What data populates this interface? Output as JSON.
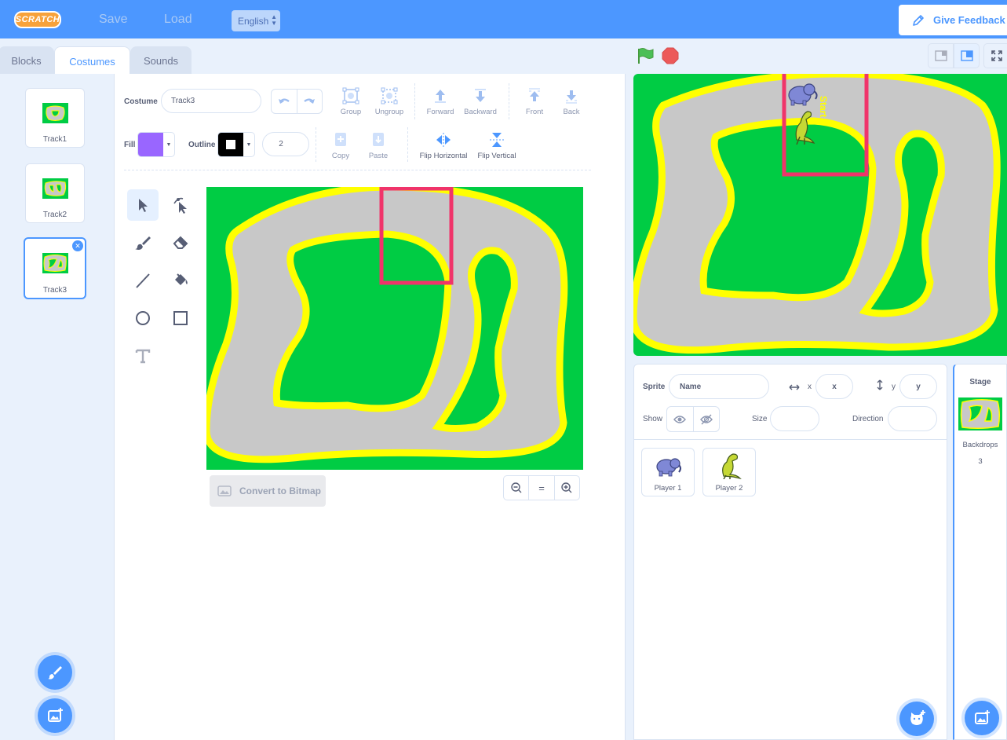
{
  "menubar": {
    "logo_text": "SCRATCH",
    "save_label": "Save",
    "load_label": "Load",
    "language": "English",
    "feedback_label": "Give Feedback"
  },
  "tabs": [
    {
      "label": "Blocks",
      "active": false
    },
    {
      "label": "Costumes",
      "active": true
    },
    {
      "label": "Sounds",
      "active": false
    }
  ],
  "costumes": [
    {
      "label": "Track1",
      "selected": false
    },
    {
      "label": "Track2",
      "selected": false
    },
    {
      "label": "Track3",
      "selected": true
    }
  ],
  "paint_editor": {
    "costume_label": "Costume",
    "costume_name": "Track3",
    "group_label": "Group",
    "ungroup_label": "Ungroup",
    "forward_label": "Forward",
    "backward_label": "Backward",
    "front_label": "Front",
    "back_label": "Back",
    "fill_label": "Fill",
    "fill_color": "#9966ff",
    "outline_label": "Outline",
    "outline_color": "#000000",
    "outline_width": "2",
    "copy_label": "Copy",
    "paste_label": "Paste",
    "flip_h_label": "Flip Horizontal",
    "flip_v_label": "Flip Vertical",
    "convert_label": "Convert to Bitmap",
    "zoom_reset": "="
  },
  "colors": {
    "accent": "#4c97ff",
    "grass": "#00cc44",
    "road": "#c8c8c8",
    "border": "#ffff00",
    "highlight": "#f0346a"
  },
  "stage_track_text": "Start",
  "sprite_info": {
    "sprite_label": "Sprite",
    "name_placeholder": "Name",
    "x_label": "x",
    "x_placeholder": "x",
    "y_label": "y",
    "y_placeholder": "y",
    "show_label": "Show",
    "size_label": "Size",
    "direction_label": "Direction"
  },
  "sprites": [
    {
      "name": "Player 1",
      "icon": "elephant-icon"
    },
    {
      "name": "Player 2",
      "icon": "dinosaur-icon"
    }
  ],
  "stage_pane": {
    "title": "Stage",
    "backdrops_label": "Backdrops",
    "backdrops_count": "3"
  }
}
